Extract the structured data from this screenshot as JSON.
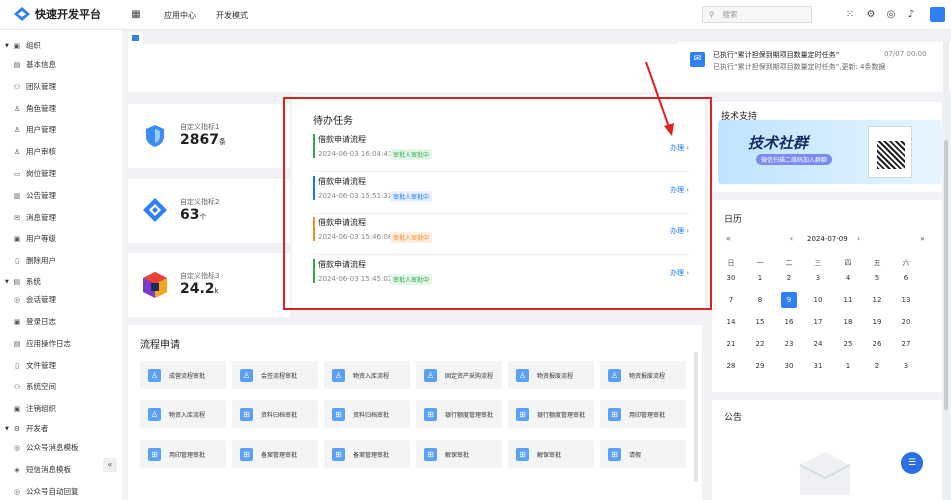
{
  "app": {
    "title": "快速开发平台"
  },
  "header": {
    "nav": [
      "应用中心",
      "开发模式"
    ],
    "search_placeholder": "搜索"
  },
  "sidebar": {
    "items": [
      {
        "label": "组织",
        "section": true
      },
      {
        "label": "基本信息"
      },
      {
        "label": "团队管理"
      },
      {
        "label": "角色管理"
      },
      {
        "label": "用户管理"
      },
      {
        "label": "用户审核"
      },
      {
        "label": "岗位管理"
      },
      {
        "label": "公告管理"
      },
      {
        "label": "消息管理"
      },
      {
        "label": "用户等级"
      },
      {
        "label": "删除用户"
      },
      {
        "label": "系统",
        "section": true
      },
      {
        "label": "会话管理"
      },
      {
        "label": "登录日志"
      },
      {
        "label": "应用操作日志"
      },
      {
        "label": "文件管理"
      },
      {
        "label": "系统空间"
      },
      {
        "label": "注销组织"
      },
      {
        "label": "开发者",
        "section": true
      },
      {
        "label": "公众号消息模板"
      },
      {
        "label": "短信消息模板"
      },
      {
        "label": "公众号自动回复"
      }
    ]
  },
  "stats": [
    {
      "label": "自定义指标1",
      "value": "2867",
      "unit": "条"
    },
    {
      "label": "自定义指标2",
      "value": "63",
      "unit": "个"
    },
    {
      "label": "自定义指标3",
      "value": "24.2",
      "unit": "k"
    }
  ],
  "todo": {
    "title": "待办任务",
    "action": "办理",
    "tasks": [
      {
        "name": "借款申请流程",
        "date": "2024-06-03 16:04:41",
        "status": "审批人审批中",
        "color": "#2fa84f"
      },
      {
        "name": "借款申请流程",
        "date": "2024-06-03 15:51:32",
        "status": "审批人审批中",
        "color": "#1677ff"
      },
      {
        "name": "借款申请流程",
        "date": "2024-06-03 15:46:08",
        "status": "审批人审批中",
        "color": "#f08a24"
      },
      {
        "name": "借款申请流程",
        "date": "2024-06-03 15:45:02",
        "status": "审批人审批中",
        "color": "#2fa84f"
      }
    ]
  },
  "flow": {
    "title": "流程申请",
    "items": [
      "成营流程审批",
      "会签流程审批",
      "物资入库流程",
      "固定资产采购流程",
      "物资报废流程",
      "物资报废流程",
      "物资入库流程",
      "资料归档审批",
      "资料归档审批",
      "银行额度管理审批",
      "银行额度管理审批",
      "用印管理审批",
      "用印管理审批",
      "备案管理审批",
      "备案管理审批",
      "解保审批",
      "解保审批",
      "请假"
    ]
  },
  "notice": {
    "title": "已执行“累计担保到期项目数量定时任务”",
    "time": "07/07 00:00",
    "desc": "已执行“累计担保到期项目数量定时任务”,更新: 4条数据"
  },
  "support": {
    "title": "技术支持",
    "banner_title": "技术社群",
    "banner_sub": "微信扫描二维码加入群聊"
  },
  "calendar": {
    "title": "日历",
    "month": "2024-07-09",
    "weekdays": [
      "日",
      "一",
      "二",
      "三",
      "四",
      "五",
      "六"
    ],
    "days": [
      "30",
      "1",
      "2",
      "3",
      "4",
      "5",
      "6",
      "7",
      "8",
      "9",
      "10",
      "11",
      "12",
      "13",
      "14",
      "15",
      "16",
      "17",
      "18",
      "19",
      "20",
      "21",
      "22",
      "23",
      "24",
      "25",
      "26",
      "27",
      "28",
      "29",
      "30",
      "31",
      "1",
      "2",
      "3"
    ],
    "selected_index": 9
  },
  "announcement": {
    "title": "公告"
  },
  "icons": {
    "brand": "#2f7ff5",
    "red_annotation": "#e02020"
  }
}
